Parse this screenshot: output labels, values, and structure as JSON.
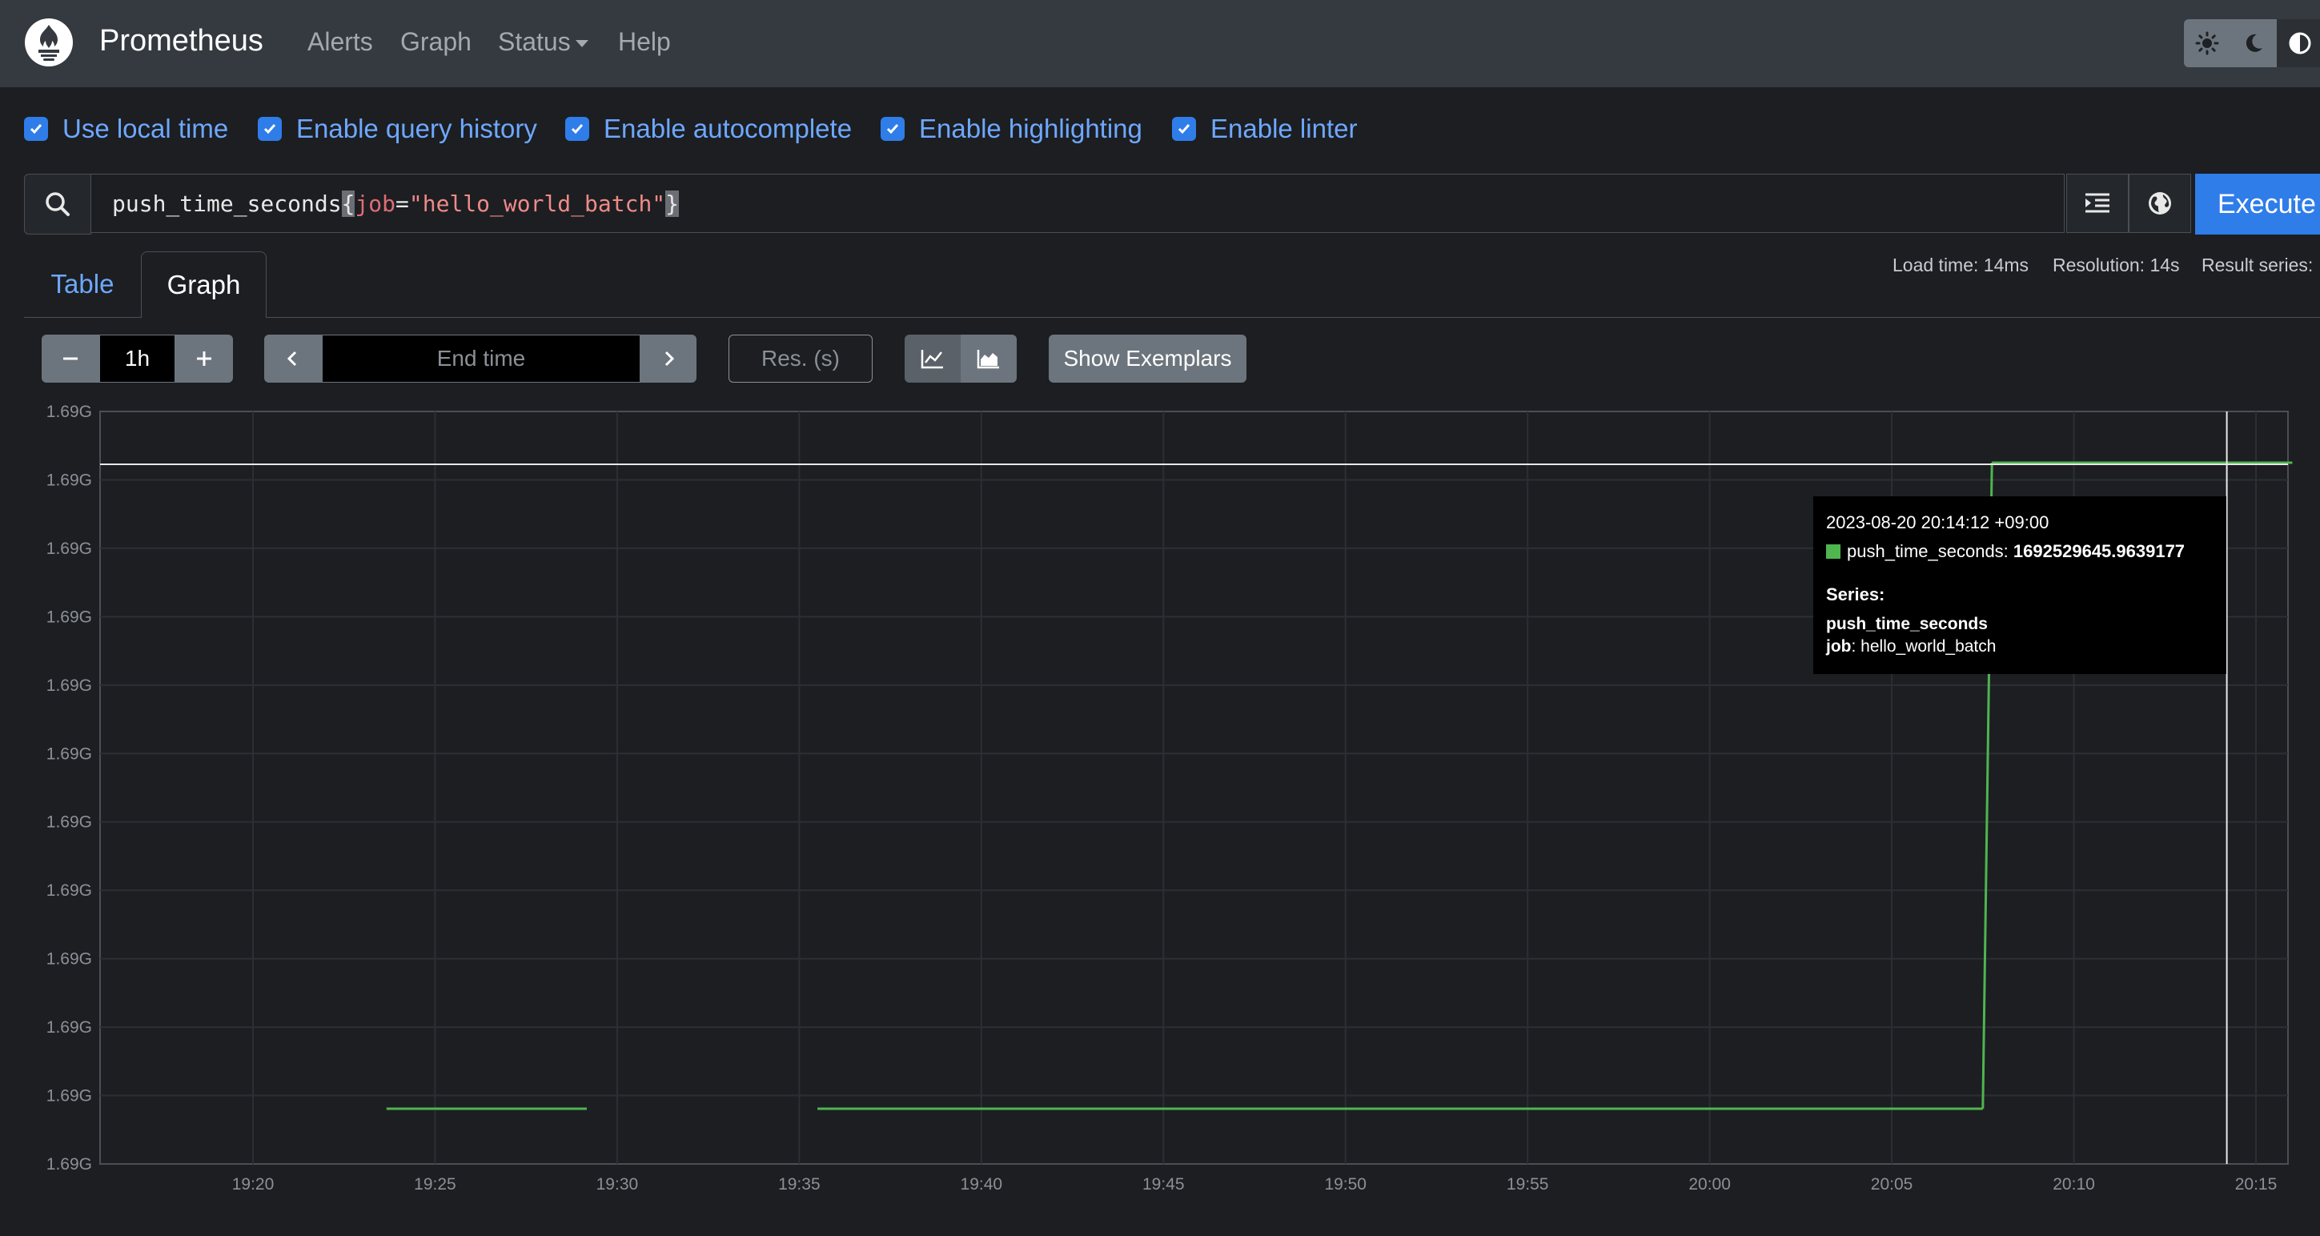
{
  "navbar": {
    "brand": "Prometheus",
    "links": [
      "Alerts",
      "Graph",
      "Status",
      "Help"
    ],
    "status_has_dropdown": true,
    "theme_buttons": [
      "sun-icon",
      "moon-icon",
      "contrast-icon"
    ]
  },
  "options": [
    {
      "label": "Use local time",
      "checked": true
    },
    {
      "label": "Enable query history",
      "checked": true
    },
    {
      "label": "Enable autocomplete",
      "checked": true
    },
    {
      "label": "Enable highlighting",
      "checked": true
    },
    {
      "label": "Enable linter",
      "checked": true
    }
  ],
  "query": {
    "metric": "push_time_seconds",
    "open_brace": "{",
    "label_name": "job",
    "equals": "=",
    "label_value": "\"hello_world_batch\"",
    "close_brace": "}",
    "execute_label": "Execute"
  },
  "tabs": {
    "table": "Table",
    "graph": "Graph",
    "active": "Graph"
  },
  "stats": {
    "load_time": "Load time: 14ms",
    "resolution": "Resolution: 14s",
    "result_series": "Result series:"
  },
  "controls": {
    "range": "1h",
    "end_time_placeholder": "End time",
    "resolution_placeholder": "Res. (s)",
    "show_exemplars": "Show Exemplars"
  },
  "chart_data": {
    "type": "line",
    "series": [
      {
        "name": "push_time_seconds",
        "color": "#4fb54f"
      }
    ],
    "x_ticks": [
      "19:20",
      "19:25",
      "19:30",
      "19:35",
      "19:40",
      "19:45",
      "19:50",
      "19:55",
      "20:00",
      "20:05",
      "20:10",
      "20:15"
    ],
    "y_ticks": [
      "1.69G",
      "1.69G",
      "1.69G",
      "1.69G",
      "1.69G",
      "1.69G",
      "1.69G",
      "1.69G",
      "1.69G",
      "1.69G",
      "1.69G",
      "1.69G"
    ],
    "segments": [
      {
        "start": "19:23:40",
        "end": "19:29:10",
        "level": "low"
      },
      {
        "start": "19:35:30",
        "end": "20:07:30",
        "level": "low"
      },
      {
        "start": "20:07:30",
        "end": "20:07:45",
        "level": "rise"
      },
      {
        "start": "20:07:45",
        "end": "20:16:00",
        "level": "high"
      }
    ],
    "hover_time": "20:14:12",
    "hover_value": 1692529645.9639177
  },
  "tooltip": {
    "timestamp": "2023-08-20 20:14:12 +09:00",
    "series_name": "push_time_seconds:",
    "value": "1692529645.9639177",
    "series_header": "Series:",
    "metric_name": "push_time_seconds",
    "label_key": "job",
    "label_value": ": hello_world_batch"
  }
}
